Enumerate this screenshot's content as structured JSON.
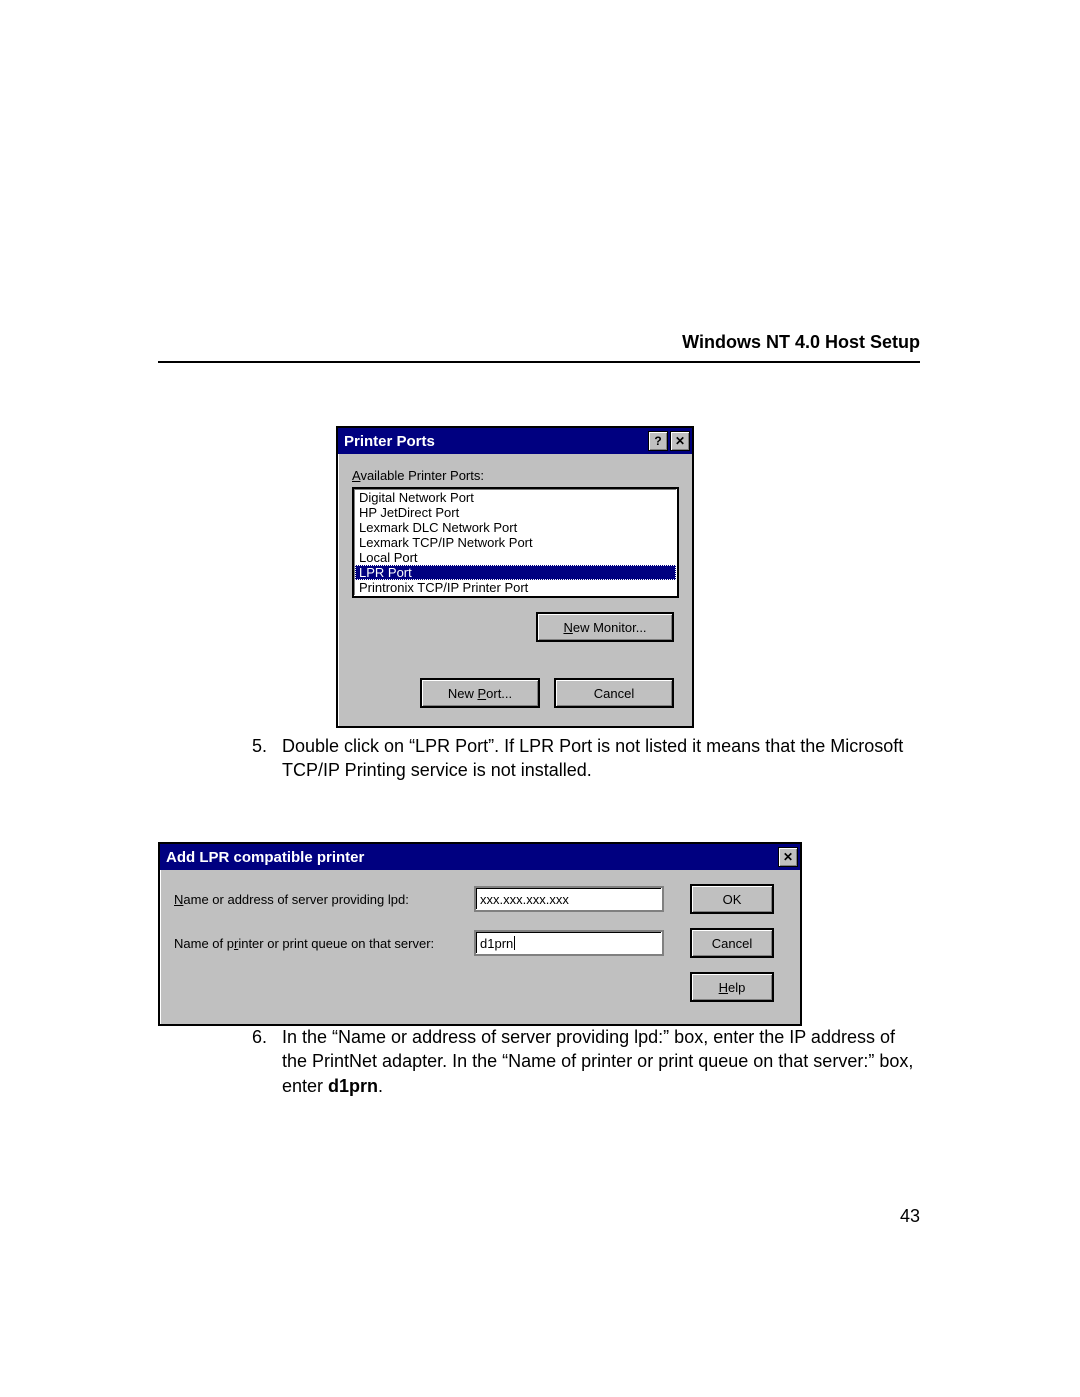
{
  "page": {
    "header": "Windows NT 4.0 Host Setup",
    "number": "43"
  },
  "dlg_ports": {
    "title": "Printer Ports",
    "help_glyph": "?",
    "close_glyph": "✕",
    "label": "Available Printer Ports:",
    "label_accel": "A",
    "items": [
      "Digital Network Port",
      "HP JetDirect Port",
      "Lexmark DLC Network Port",
      "Lexmark TCP/IP Network Port",
      "Local Port",
      "LPR Port",
      "Printronix TCP/IP Printer Port"
    ],
    "selected_index": 5,
    "btn_new_monitor": "New Monitor...",
    "btn_new_monitor_accel": "N",
    "btn_new_port": "New Port...",
    "btn_new_port_accel": "P",
    "btn_cancel": "Cancel"
  },
  "instructions": {
    "step5_num": "5.",
    "step5_text": "Double click on “LPR Port”. If LPR Port is not listed it means that the Microsoft TCP/IP Printing service is not installed.",
    "step6_num": "6.",
    "step6_text_a": "In the “Name or address of server providing lpd:” box, enter the IP address of the PrintNet adapter. In the “Name of printer or print queue on that server:” box, enter ",
    "step6_bold": "d1prn",
    "step6_text_b": "."
  },
  "dlg_lpr": {
    "title": "Add LPR compatible printer",
    "close_glyph": "✕",
    "label_server": "Name or address of server providing lpd:",
    "label_server_accel": "N",
    "label_queue": "Name of printer or print queue on that server:",
    "label_queue_accel": "R",
    "value_server": "xxx.xxx.xxx.xxx",
    "value_queue": "d1prn",
    "btn_ok": "OK",
    "btn_cancel": "Cancel",
    "btn_help": "Help",
    "btn_help_accel": "H"
  }
}
